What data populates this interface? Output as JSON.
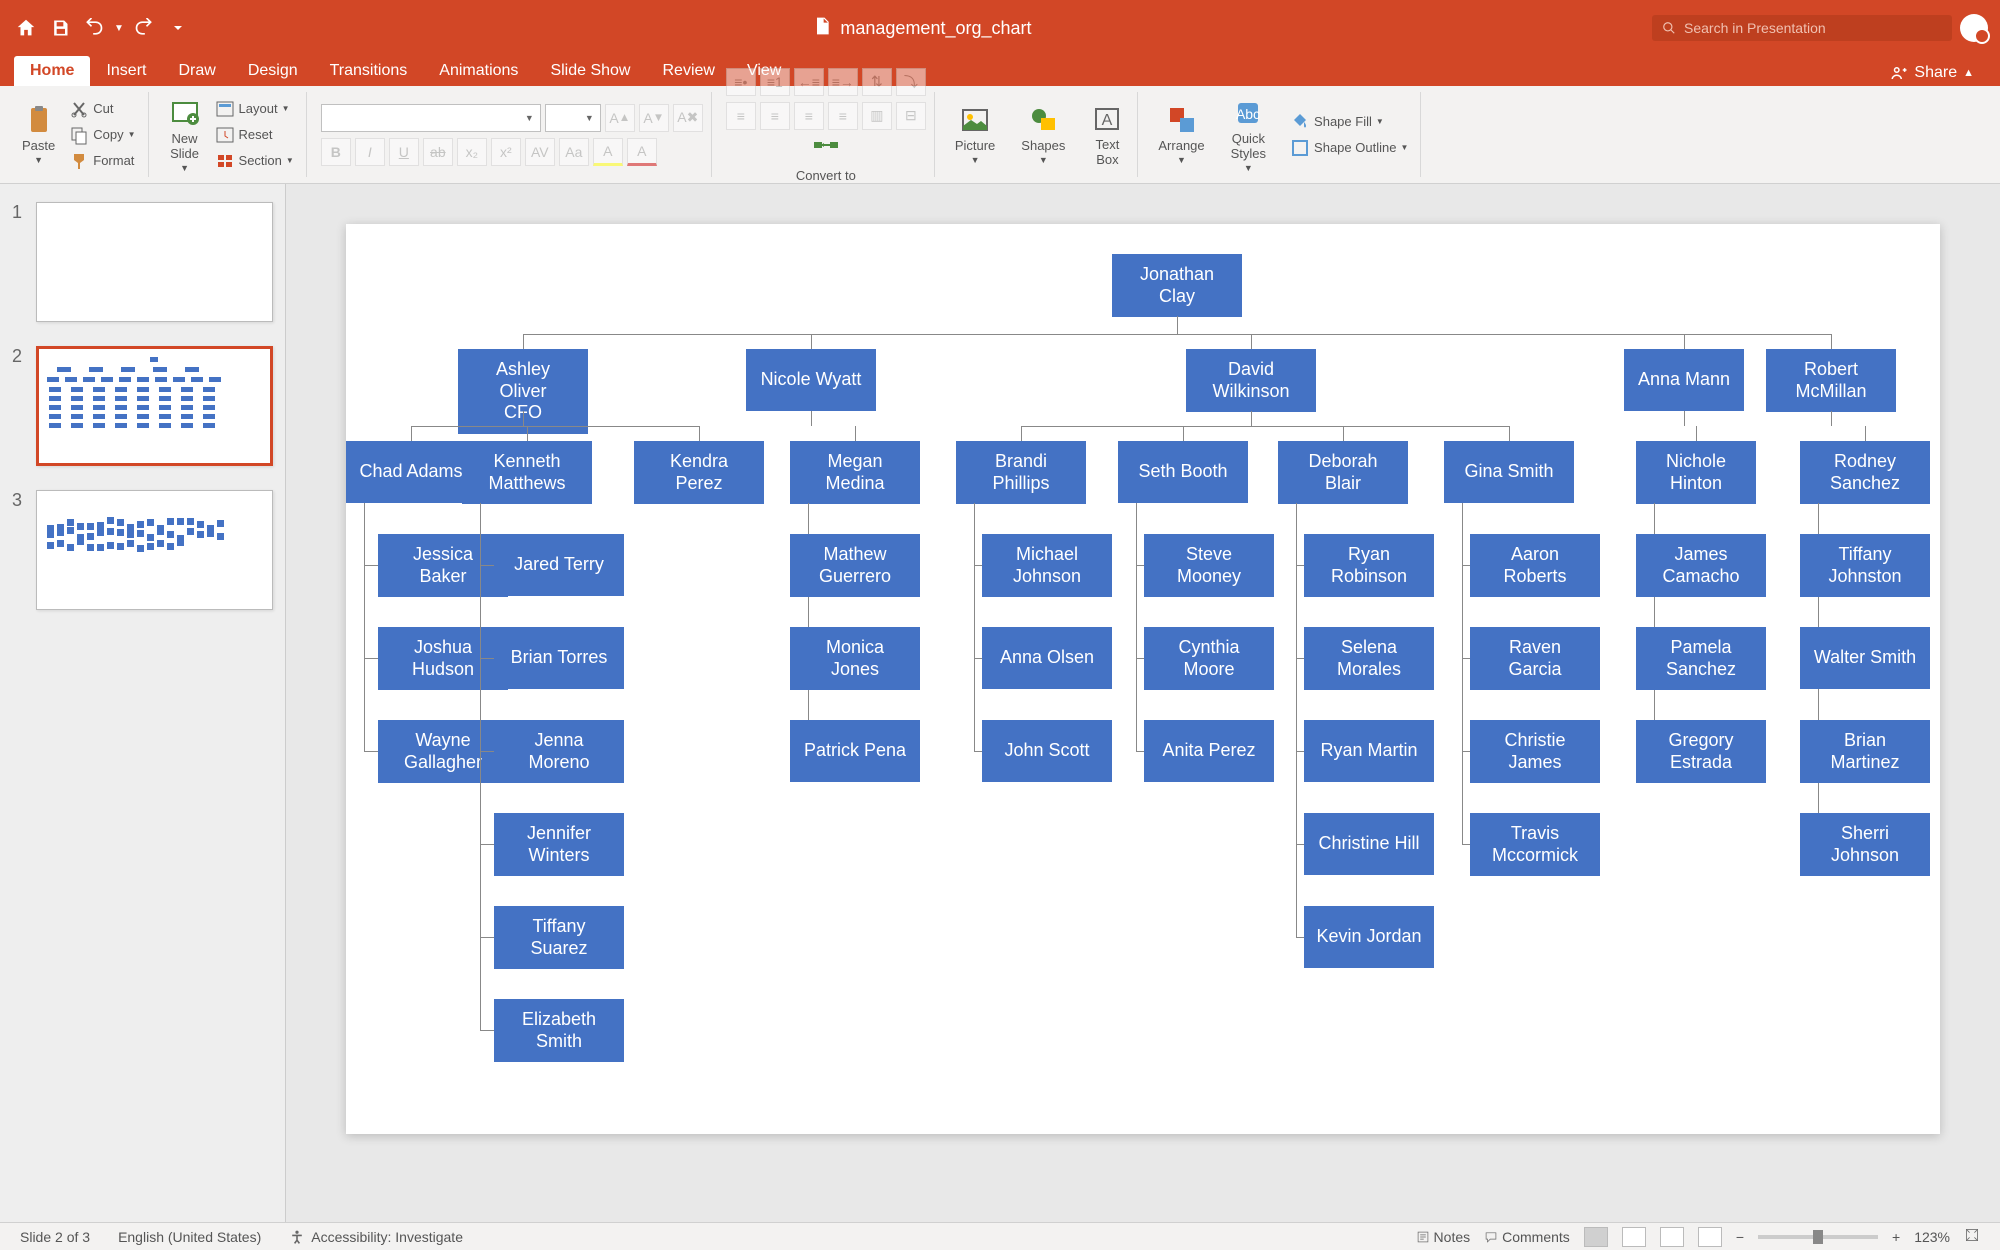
{
  "app": {
    "document_title": "management_org_chart",
    "search_placeholder": "Search in Presentation"
  },
  "tabs": [
    "Home",
    "Insert",
    "Draw",
    "Design",
    "Transitions",
    "Animations",
    "Slide Show",
    "Review",
    "View"
  ],
  "share_label": "Share",
  "ribbon": {
    "paste": "Paste",
    "cut": "Cut",
    "copy": "Copy",
    "format": "Format",
    "new_slide": "New\nSlide",
    "layout": "Layout",
    "reset": "Reset",
    "section": "Section",
    "convert": "Convert to\nSmartArt",
    "picture": "Picture",
    "shapes": "Shapes",
    "text_box": "Text\nBox",
    "arrange": "Arrange",
    "quick_styles": "Quick\nStyles",
    "shape_fill": "Shape Fill",
    "shape_outline": "Shape Outline"
  },
  "slide_numbers": [
    "1",
    "2",
    "3"
  ],
  "org_chart": {
    "root": "Jonathan\nClay",
    "level2": [
      {
        "name": "Ashley Oliver\nCFO"
      },
      {
        "name": "Nicole Wyatt"
      },
      {
        "name": "David\nWilkinson"
      },
      {
        "name": "Anna Mann"
      },
      {
        "name": "Robert\nMcMillan"
      }
    ],
    "level3": [
      {
        "name": "Chad Adams"
      },
      {
        "name": "Kenneth\nMatthews"
      },
      {
        "name": "Kendra Perez"
      },
      {
        "name": "Megan\nMedina"
      },
      {
        "name": "Brandi\nPhillips"
      },
      {
        "name": "Seth Booth"
      },
      {
        "name": "Deborah\nBlair"
      },
      {
        "name": "Gina Smith"
      },
      {
        "name": "Nichole\nHinton"
      },
      {
        "name": "Rodney\nSanchez"
      }
    ],
    "leaves": {
      "chad": [
        "Jessica Baker",
        "Joshua\nHudson",
        "Wayne\nGallagher"
      ],
      "kenneth": [
        "Jared Terry",
        "Brian Torres",
        "Jenna\nMoreno",
        "Jennifer\nWinters",
        "Tiffany\nSuarez",
        "Elizabeth\nSmith"
      ],
      "megan": [
        "Mathew\nGuerrero",
        "Monica Jones",
        "Patrick Pena"
      ],
      "brandi": [
        "Michael\nJohnson",
        "Anna Olsen",
        "John Scott"
      ],
      "seth": [
        "Steve\nMooney",
        "Cynthia\nMoore",
        "Anita Perez"
      ],
      "deborah": [
        "Ryan\nRobinson",
        "Selena\nMorales",
        "Ryan Martin",
        "Christine Hill",
        "Kevin Jordan"
      ],
      "gina": [
        "Aaron\nRoberts",
        "Raven Garcia",
        "Christie\nJames",
        "Travis\nMccormick"
      ],
      "nichole": [
        "James\nCamacho",
        "Pamela\nSanchez",
        "Gregory\nEstrada"
      ],
      "rodney": [
        "Tiffany\nJohnston",
        "Walter Smith",
        "Brian\nMartinez",
        "Sherri\nJohnson"
      ]
    }
  },
  "status": {
    "slide_info": "Slide 2 of 3",
    "language": "English (United States)",
    "accessibility": "Accessibility: Investigate",
    "notes": "Notes",
    "comments": "Comments",
    "zoom": "123%"
  }
}
